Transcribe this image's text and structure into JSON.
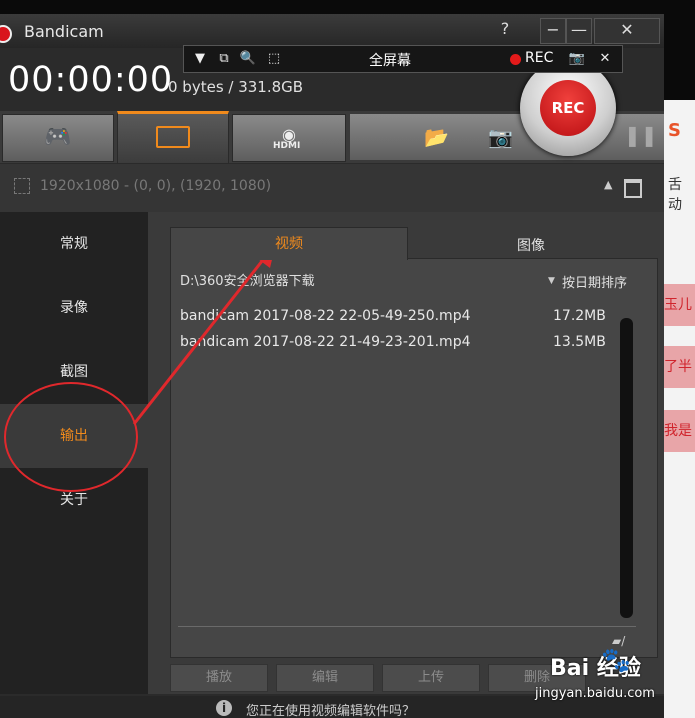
{
  "window": {
    "title": "Bandicam"
  },
  "titlebar": {
    "help": "?",
    "minimize": "−",
    "restore": "—",
    "close": "✕"
  },
  "toolbar": {
    "fullscreen": "全屏幕",
    "rec": "REC",
    "close": "✕"
  },
  "timer": "00:00:00",
  "storage": "0 bytes / 331.8GB",
  "rec_button": "REC",
  "region": {
    "text": "1920x1080 - (0, 0), (1920, 1080)"
  },
  "sidebar": {
    "items": [
      "常规",
      "录像",
      "截图",
      "输出",
      "关于"
    ],
    "active": 3
  },
  "output": {
    "tabs": [
      "视频",
      "图像"
    ],
    "path": "D:\\360安全浏览器下载",
    "sort": "按日期排序",
    "files": [
      {
        "name": "bandicam 2017-08-22 22-05-49-250.mp4",
        "size": "17.2MB"
      },
      {
        "name": "bandicam 2017-08-22 21-49-23-201.mp4",
        "size": "13.5MB"
      }
    ],
    "folder_suffix": "/",
    "buttons": [
      "播放",
      "编辑",
      "上传",
      "删除"
    ]
  },
  "status": {
    "text": "您正在使用视频编辑软件吗？"
  },
  "background_page": {
    "strips": [
      "舌动",
      "玉儿",
      "了半",
      "我是"
    ]
  },
  "watermark": {
    "main": "Bai  经验",
    "sub": "jingyan.baidu.com"
  },
  "colors": {
    "accent": "#f08a1c",
    "rec": "#d9141c",
    "annotation": "#e0282c"
  }
}
